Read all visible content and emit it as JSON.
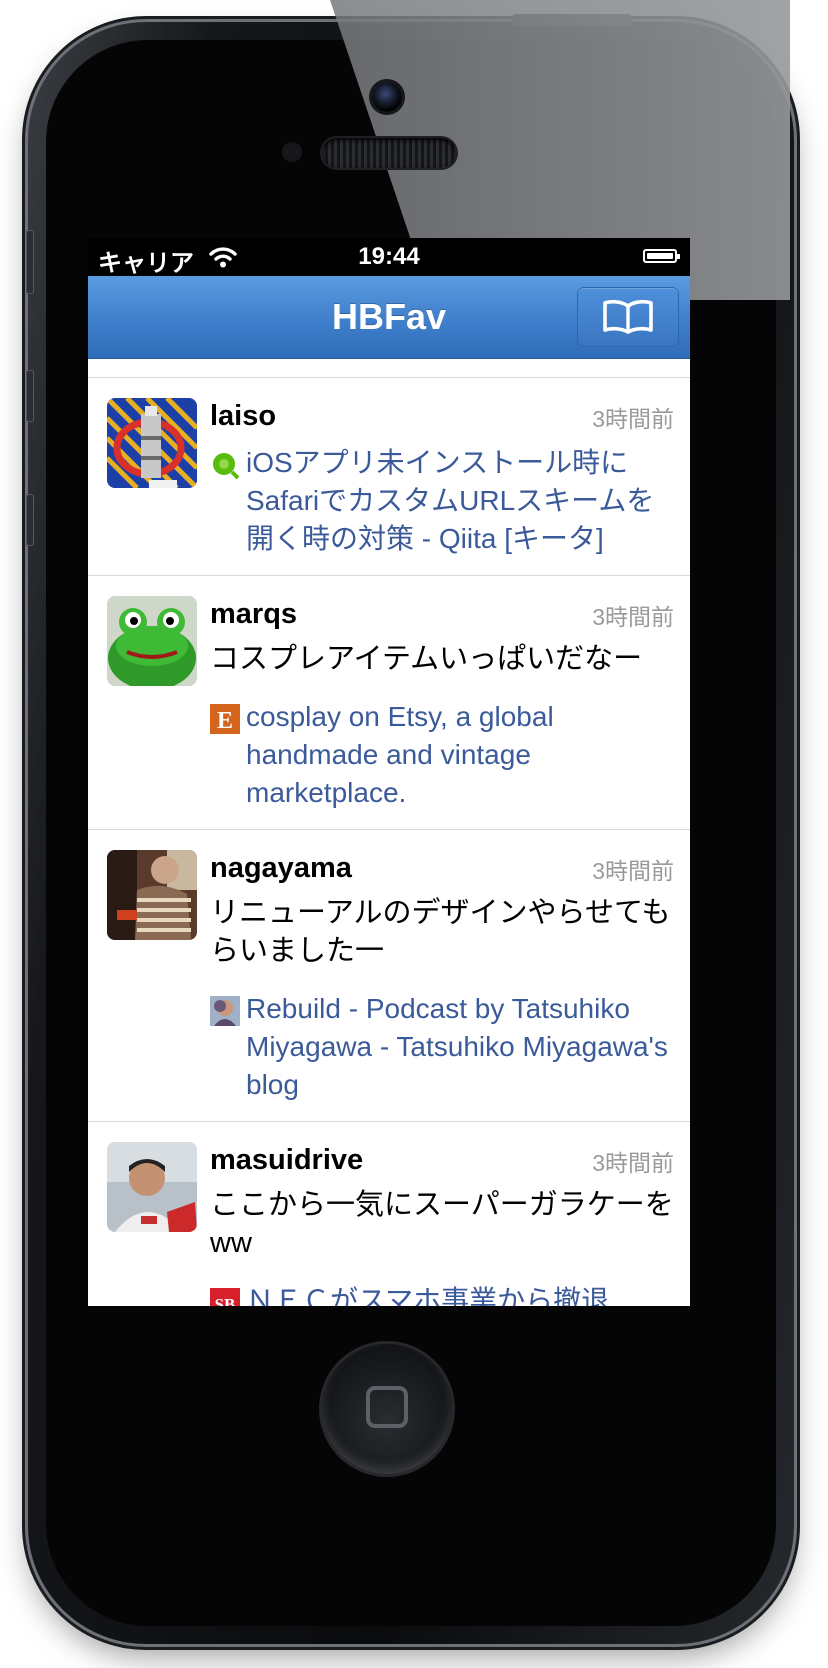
{
  "status_bar": {
    "carrier": "キャリア",
    "time": "19:44"
  },
  "nav": {
    "title": "HBFav",
    "right_button_icon": "book-icon"
  },
  "entries": [
    {
      "username": "laiso",
      "time": "3時間前",
      "comment": "",
      "favicon": "qiita-favicon",
      "bookmark_title": "iOSアプリ未インストール時にSafariでカスタムURLスキームを開く時の対策 - Qiita [キータ]"
    },
    {
      "username": "marqs",
      "time": "3時間前",
      "comment": "コスプレアイテムいっぱいだなー",
      "favicon": "etsy-favicon",
      "bookmark_title": "cosplay on Etsy, a global handmade and vintage marketplace."
    },
    {
      "username": "nagayama",
      "time": "3時間前",
      "comment": "リニューアルのデザインやらせてもらいました一",
      "favicon": "rebuild-favicon",
      "bookmark_title": "Rebuild - Podcast by Tatsuhiko Miyagawa - Tatsuhiko Miyagawa's blog"
    },
    {
      "username": "masuidrive",
      "time": "3時間前",
      "comment": "ここから一気にスーパーガラケーをww",
      "favicon": "sb-favicon",
      "bookmark_title": "ＮＥＣがスマホ事業から撤退"
    }
  ],
  "colors": {
    "nav_blue": "#3f7fcb",
    "link_blue": "#3b5a9a",
    "timestamp_gray": "#9a9a9a"
  }
}
